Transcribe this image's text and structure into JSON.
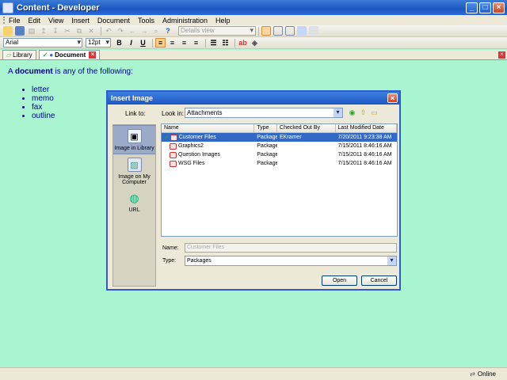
{
  "window": {
    "title": "Content - Developer",
    "min": "_",
    "max": "□",
    "close": "×"
  },
  "menu": [
    "File",
    "Edit",
    "View",
    "Insert",
    "Document",
    "Tools",
    "Administration",
    "Help"
  ],
  "toolbar": {
    "view_select": "Details view"
  },
  "format": {
    "font": "Arial",
    "size": "12pt",
    "bold": "B",
    "italic": "I",
    "underline": "U"
  },
  "tabs": [
    {
      "label": "Library"
    },
    {
      "label": "Document",
      "close": "×"
    }
  ],
  "document": {
    "intro_prefix": "A ",
    "intro_bold": "document",
    "intro_suffix": " is any of the following:",
    "items": [
      "letter",
      "memo",
      "fax",
      "outline"
    ]
  },
  "status": {
    "text": "Online"
  },
  "dialog": {
    "title": "Insert Image",
    "close": "×",
    "link_to_label": "Link to:",
    "look_in_label": "Look in:",
    "look_in_value": "Attachments",
    "sidebar": [
      {
        "label": "Image in Library"
      },
      {
        "label": "Image on My Computer"
      },
      {
        "label": "URL"
      }
    ],
    "columns": [
      "Name",
      "Type",
      "Checked Out By",
      "Last Modified Date"
    ],
    "rows": [
      {
        "name": "Customer Files",
        "type": "Package",
        "checked_out_by": "EKramer",
        "date": "7/20/2011 9:23:38 AM"
      },
      {
        "name": "Graphics2",
        "type": "Package",
        "checked_out_by": "",
        "date": "7/15/2011 8:46:16 AM"
      },
      {
        "name": "Question Images",
        "type": "Package",
        "checked_out_by": "",
        "date": "7/15/2011 8:46:16 AM"
      },
      {
        "name": "WSG Files",
        "type": "Package",
        "checked_out_by": "",
        "date": "7/15/2011 8:46:16 AM"
      }
    ],
    "name_label": "Name:",
    "name_value": "Customer Files",
    "type_label": "Type:",
    "type_value": "Packages",
    "open_button": "Open",
    "cancel_button": "Cancel"
  }
}
